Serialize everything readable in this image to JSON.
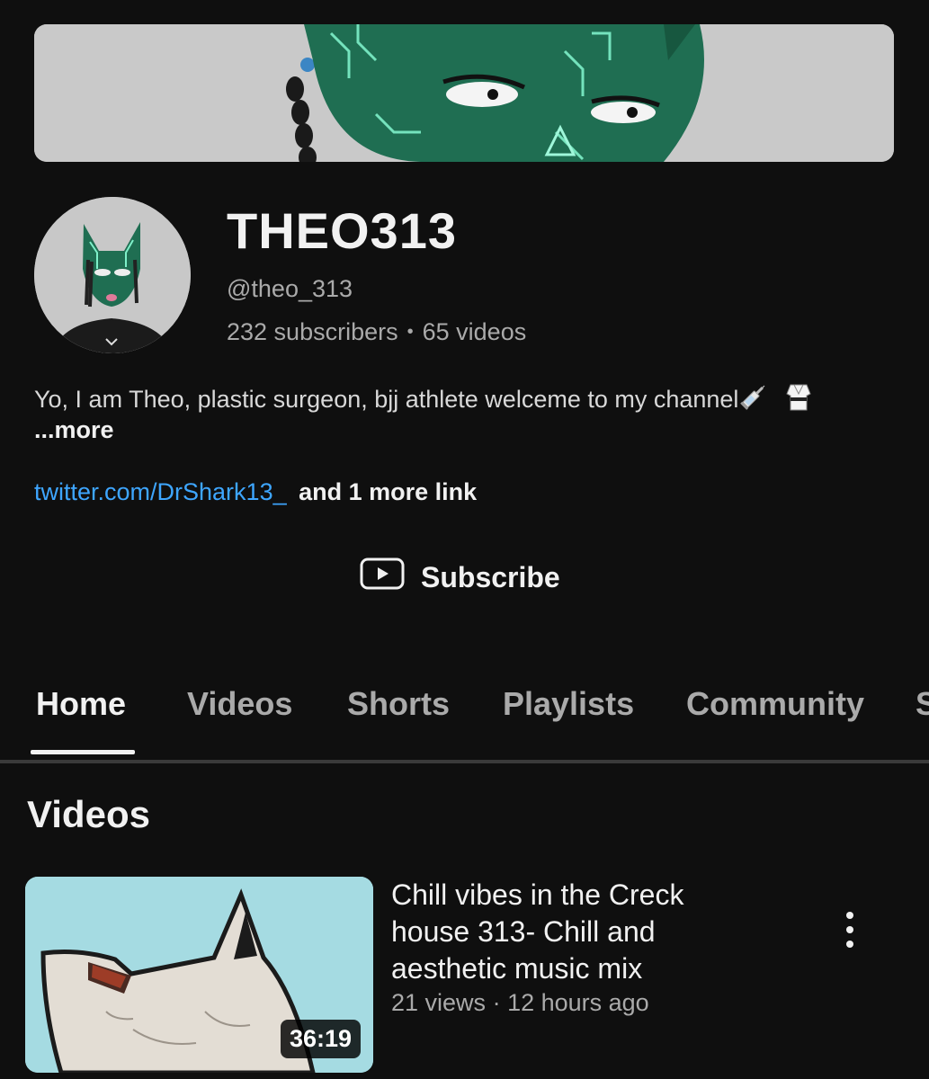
{
  "channel": {
    "name": "THEO313",
    "handle": "@theo_313",
    "subscribers": "232 subscribers",
    "separator": "•",
    "videos": "65 videos",
    "description": "Yo, I am Theo, plastic surgeon, bjj athlete welceme to my channel",
    "description_emojis": [
      "syringe-emoji",
      "martial-arts-uniform-emoji"
    ],
    "more_label": "...more",
    "link_url": "twitter.com/DrShark13_",
    "link_extra": "and 1 more link",
    "subscribe_label": "Subscribe"
  },
  "tabs": [
    {
      "label": "Home",
      "active": true
    },
    {
      "label": "Videos",
      "active": false
    },
    {
      "label": "Shorts",
      "active": false
    },
    {
      "label": "Playlists",
      "active": false
    },
    {
      "label": "Community",
      "active": false
    },
    {
      "label": "S",
      "active": false
    }
  ],
  "section": {
    "title": "Videos"
  },
  "video": {
    "title": "Chill vibes in the Creck house 313- Chill and aesthetic music mix",
    "views": "21 views",
    "dot": "·",
    "age": "12 hours ago",
    "duration": "36:19"
  },
  "colors": {
    "background": "#0f0f0f",
    "link": "#3ea6ff",
    "muted_text": "#aaaaaa",
    "character_green": "#1f6e52"
  }
}
